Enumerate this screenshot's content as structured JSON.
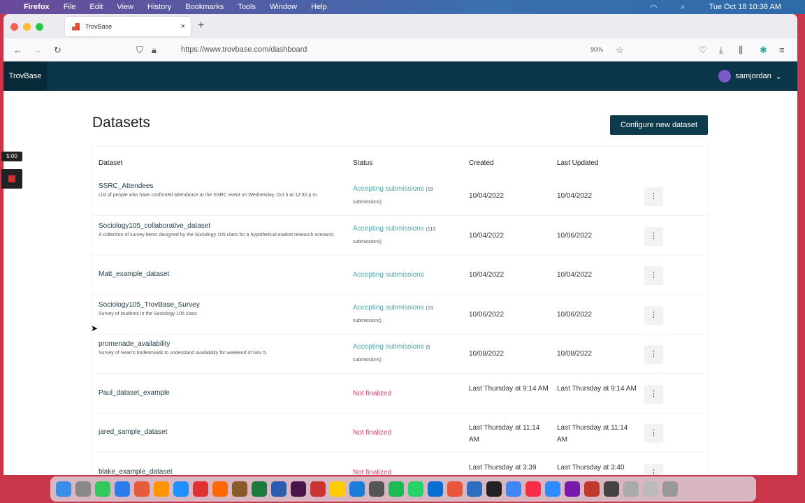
{
  "menubar": {
    "app": "Firefox",
    "items": [
      "File",
      "Edit",
      "View",
      "History",
      "Bookmarks",
      "Tools",
      "Window",
      "Help"
    ],
    "datetime": "Tue Oct 18  10:38 AM"
  },
  "browser": {
    "tab_title": "TrovBase",
    "url": "https://www.trovbase.com/dashboard",
    "zoom": "90%"
  },
  "app": {
    "brand": "TrovBase",
    "user": "samjordan"
  },
  "page": {
    "title": "Datasets",
    "configure_label": "Configure new dataset"
  },
  "recorder": {
    "timer": "5:00"
  },
  "table": {
    "headers": [
      "Dataset",
      "Status",
      "Created",
      "Last Updated"
    ],
    "rows": [
      {
        "name": "SSRC_Attendees",
        "desc": "List of people who have confirmed attendance at the SSRC event on Wednesday, Oct 5 at 12:30 p.m.",
        "status": "Accepting submissions",
        "count": "(19 submissions)",
        "kind": "acc",
        "created": "10/04/2022",
        "updated": "10/04/2022"
      },
      {
        "name": "Sociology105_collaborative_dataset",
        "desc": "A collection of survey items designed by the Sociology 105 class for a hypothetical market research scenario.",
        "status": "Accepting submissions",
        "count": "(113 submissions)",
        "kind": "acc",
        "created": "10/04/2022",
        "updated": "10/06/2022"
      },
      {
        "name": "Matt_example_dataset",
        "desc": "",
        "status": "Accepting submissions",
        "count": "",
        "kind": "acc",
        "created": "10/04/2022",
        "updated": "10/04/2022"
      },
      {
        "name": "Sociology105_TrovBase_Survey",
        "desc": "Survey of students in the Sociology 105 class",
        "status": "Accepting submissions",
        "count": "(19 submissions)",
        "kind": "acc",
        "created": "10/06/2022",
        "updated": "10/06/2022"
      },
      {
        "name": "promenade_availability",
        "desc": "Survey of Sean's bridesmaids to understand availability for weekend of Nov 5.",
        "status": "Accepting submissions",
        "count": "(6 submissions)",
        "kind": "acc",
        "created": "10/08/2022",
        "updated": "10/08/2022"
      },
      {
        "name": "Paul_dataset_example",
        "desc": "",
        "status": "Not finalized",
        "count": "",
        "kind": "nf",
        "created": "Last Thursday at 9:14 AM",
        "updated": "Last Thursday at 9:14 AM"
      },
      {
        "name": "jared_sample_dataset",
        "desc": "",
        "status": "Not finalized",
        "count": "",
        "kind": "nf",
        "created": "Last Thursday at 11:14 AM",
        "updated": "Last Thursday at 11:14 AM"
      },
      {
        "name": "blake_example_dataset",
        "desc": "",
        "status": "Not finalized",
        "count": "",
        "kind": "nf",
        "created": "Last Thursday at 3:39",
        "updated": "Last Thursday at 3:40"
      }
    ]
  },
  "colors": {
    "header": "#0b3548",
    "accepting": "#4aa8a8",
    "not_finalized": "#d23f6e",
    "button": "#0d3a4c"
  }
}
